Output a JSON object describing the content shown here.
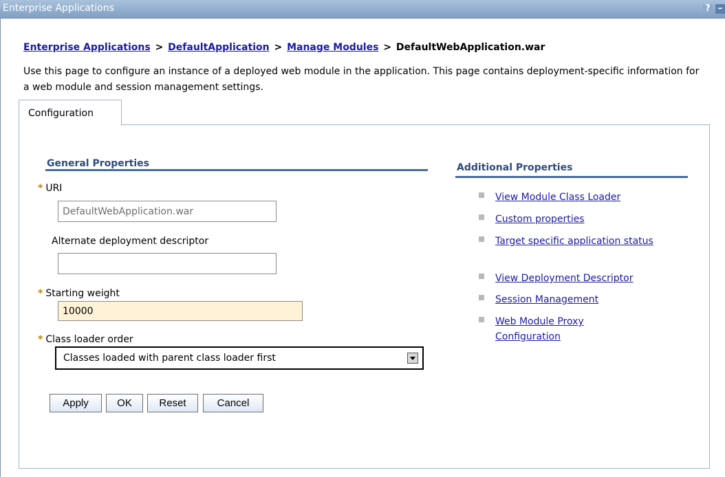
{
  "window": {
    "title": "Enterprise Applications",
    "help_label": "?",
    "min_label": "–"
  },
  "breadcrumb": {
    "items": [
      "Enterprise Applications",
      "DefaultApplication",
      "Manage Modules"
    ],
    "separator": ">",
    "current": "DefaultWebApplication.war"
  },
  "description": "Use this page to configure an instance of a deployed web module in the application. This page contains deployment-specific information for a web module and session management settings.",
  "tabs": [
    {
      "label": "Configuration"
    }
  ],
  "general": {
    "title": "General Properties",
    "required_mark": "*",
    "uri": {
      "label": "URI",
      "value": "DefaultWebApplication.war"
    },
    "alt_dd": {
      "label": "Alternate deployment descriptor",
      "value": ""
    },
    "starting_weight": {
      "label": "Starting weight",
      "value": "10000"
    },
    "class_loader": {
      "label": "Class loader order",
      "selected": "Classes loaded with parent class loader first"
    }
  },
  "buttons": {
    "apply": "Apply",
    "ok": "OK",
    "reset": "Reset",
    "cancel": "Cancel"
  },
  "additional": {
    "title": "Additional Properties",
    "items": [
      "View Module Class Loader",
      "Custom properties",
      "Target specific application status",
      "View Deployment Descriptor",
      "Session Management",
      "Web Module Proxy Configuration"
    ]
  },
  "colors": {
    "link": "#1a1aa6",
    "section_title": "#2d4b7e",
    "section_rule": "#456c9e",
    "titlebar": "#8ba8cb",
    "highlight_field": "#fff2d6"
  }
}
